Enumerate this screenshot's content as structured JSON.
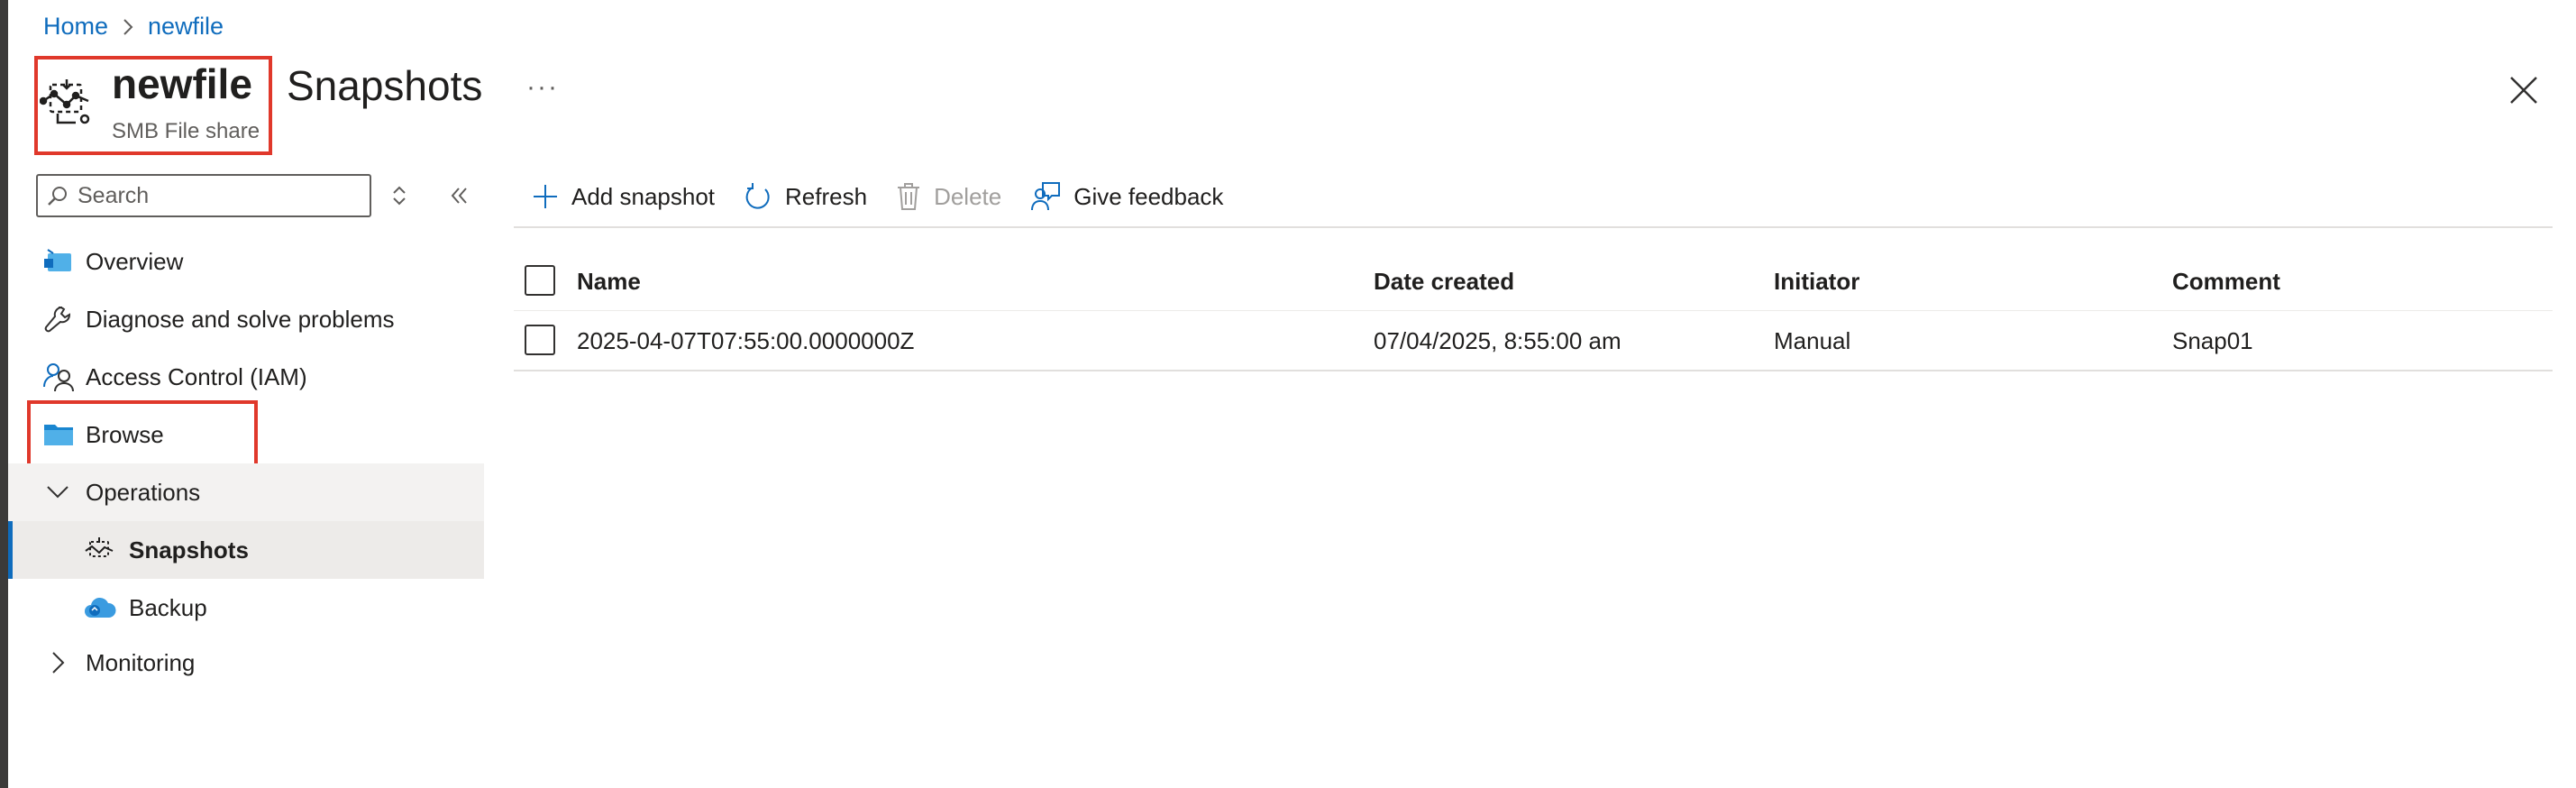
{
  "breadcrumb": {
    "home": "Home",
    "current": "newfile"
  },
  "resource": {
    "name": "newfile",
    "type": "SMB File share"
  },
  "page": {
    "title": "Snapshots",
    "more": "···"
  },
  "search": {
    "placeholder": "Search"
  },
  "sidebar": {
    "items": [
      {
        "label": "Overview",
        "icon": "overview-icon"
      },
      {
        "label": "Diagnose and solve problems",
        "icon": "wrench-icon"
      },
      {
        "label": "Access Control (IAM)",
        "icon": "people-icon"
      },
      {
        "label": "Browse",
        "icon": "folder-icon"
      },
      {
        "label": "Operations",
        "icon": "chevron-down-icon",
        "expanded": true
      },
      {
        "label": "Snapshots",
        "icon": "snapshot-icon",
        "selected": true
      },
      {
        "label": "Backup",
        "icon": "backup-cloud-icon"
      },
      {
        "label": "Monitoring",
        "icon": "chevron-right-icon",
        "expanded": false
      }
    ]
  },
  "toolbar": {
    "add": "Add snapshot",
    "refresh": "Refresh",
    "delete": "Delete",
    "feedback": "Give feedback"
  },
  "table": {
    "columns": [
      "Name",
      "Date created",
      "Initiator",
      "Comment"
    ],
    "rows": [
      {
        "name": "2025-04-07T07:55:00.0000000Z",
        "date": "07/04/2025, 8:55:00 am",
        "initiator": "Manual",
        "comment": "Snap01"
      }
    ]
  },
  "colors": {
    "accent": "#0f6cbd",
    "highlight": "#e0382b",
    "selected_bg": "#edebe9"
  }
}
